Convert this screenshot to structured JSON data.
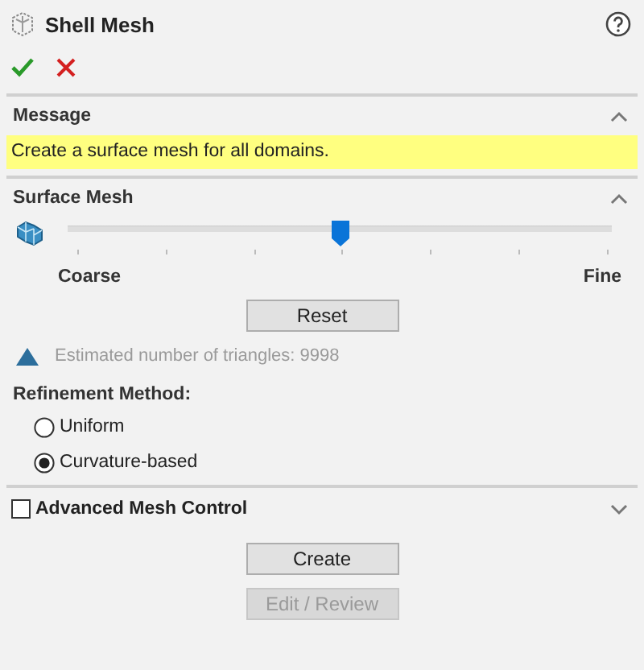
{
  "panel": {
    "title": "Shell Mesh"
  },
  "message": {
    "title": "Message",
    "expanded": true,
    "text": "Create a surface mesh for all domains."
  },
  "surface_mesh": {
    "title": "Surface Mesh",
    "expanded": true,
    "slider": {
      "level": 0.5
    },
    "min_label": "Coarse",
    "max_label": "Fine",
    "reset_button": "Reset",
    "estimate": "Estimated number of triangles: 9998",
    "refinement_label": "Refinement Method:",
    "options": [
      {
        "label": "Uniform",
        "selected": false
      },
      {
        "label": "Curvature-based",
        "selected": true
      }
    ]
  },
  "advanced": {
    "title": "Advanced Mesh Control",
    "checked": false,
    "expanded": false
  },
  "buttons": [
    {
      "label": "Create",
      "disabled": false
    },
    {
      "label": "Edit / Review",
      "disabled": true
    }
  ]
}
